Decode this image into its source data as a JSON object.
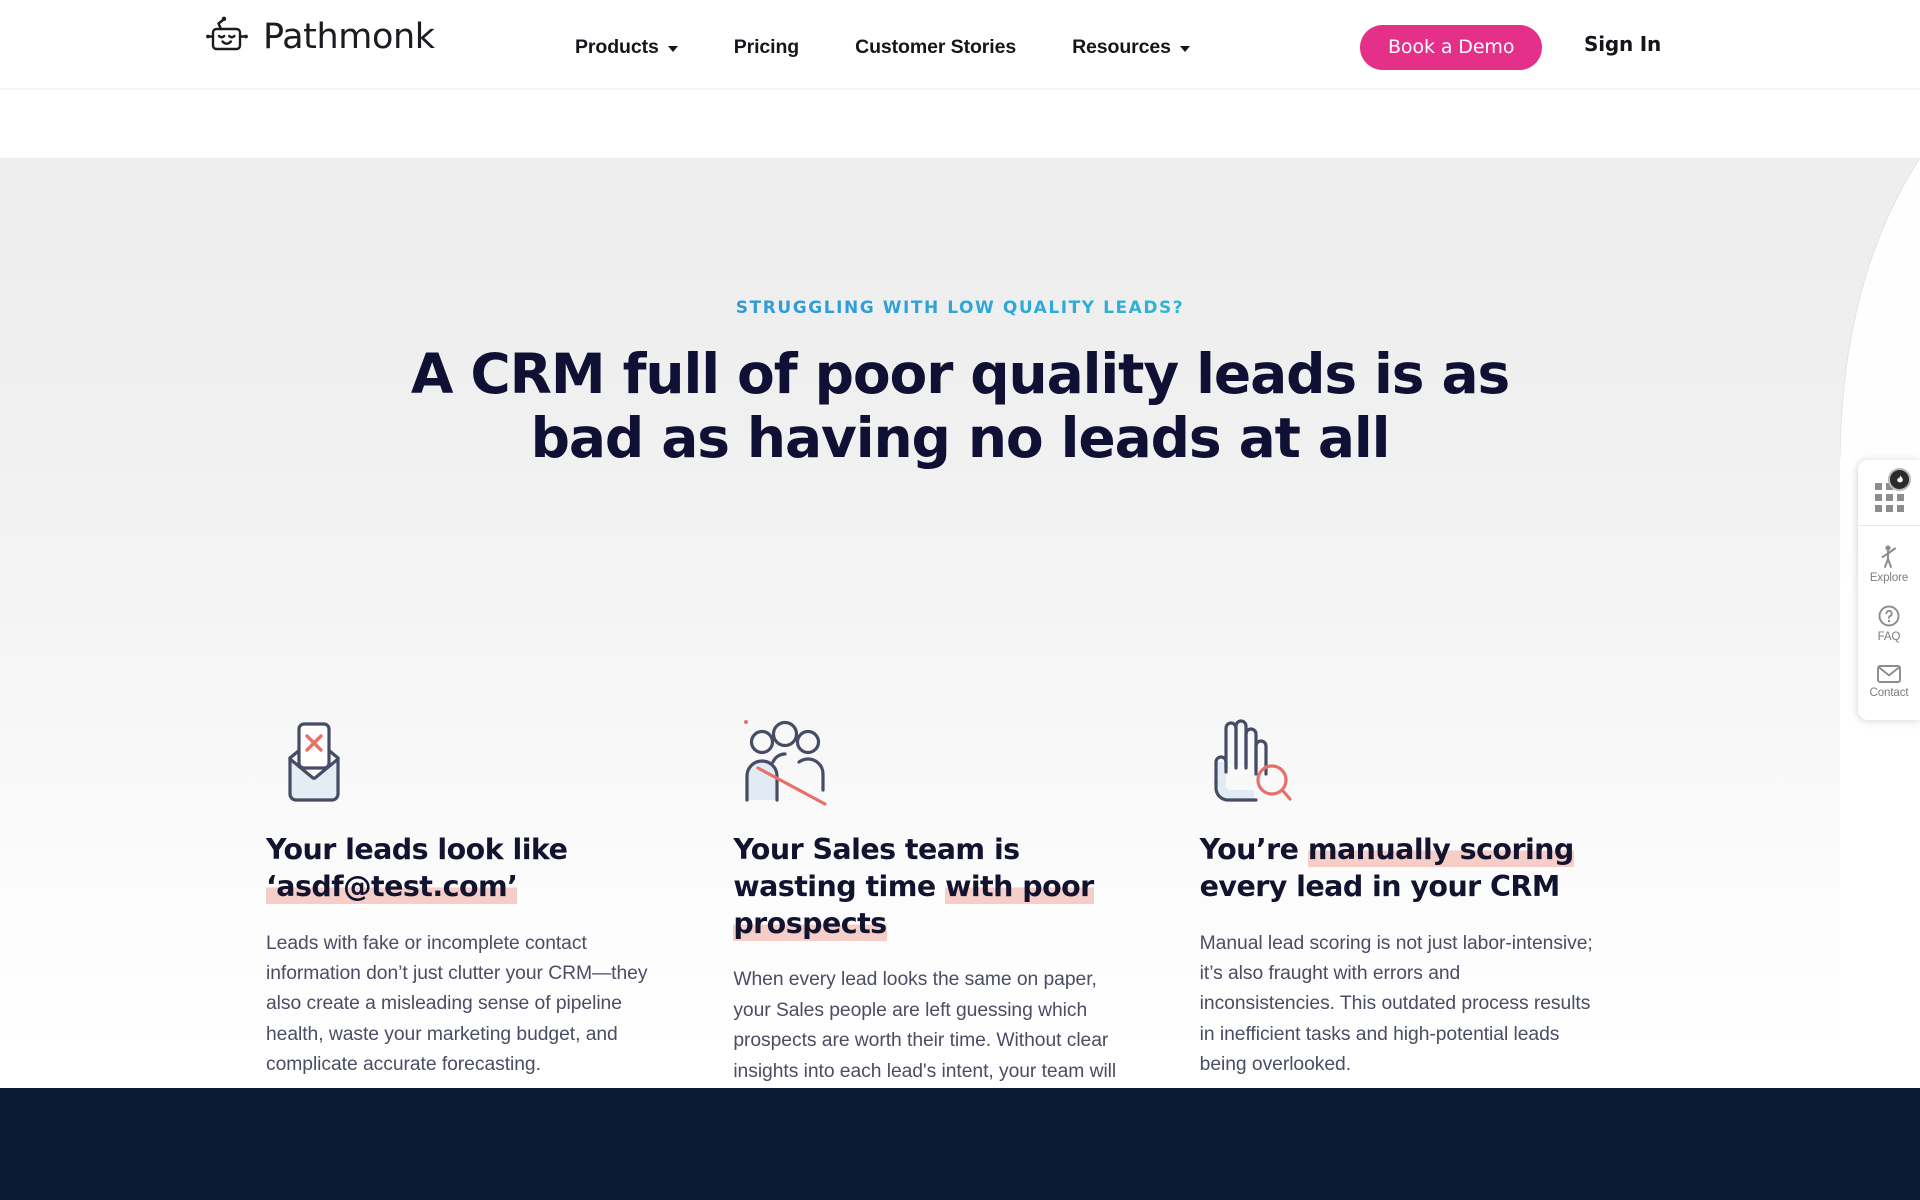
{
  "header": {
    "brand": "Pathmonk",
    "brand_icon": "robot-logo-icon",
    "nav": [
      {
        "label": "Products",
        "has_caret": true,
        "name": "nav-products"
      },
      {
        "label": "Pricing",
        "has_caret": false,
        "name": "nav-pricing"
      },
      {
        "label": "Customer Stories",
        "has_caret": false,
        "name": "nav-customer-stories"
      },
      {
        "label": "Resources",
        "has_caret": true,
        "name": "nav-resources"
      }
    ],
    "cta_label": "Book a Demo",
    "signin_label": "Sign In",
    "cta_color": "#e5308a"
  },
  "hero": {
    "eyebrow": "STRUGGLING WITH LOW QUALITY LEADS?",
    "eyebrow_gradient_from": "#3d7fd4",
    "eyebrow_gradient_to": "#36dbe0",
    "headline": "A CRM full of poor quality leads is as bad as having no leads at all",
    "headline_color": "#0f1033"
  },
  "cards": [
    {
      "icon": "envelope-x-icon",
      "title_plain": "Your leads look like ",
      "title_highlight": "‘asdf@test.com’",
      "body": "Leads with fake or incomplete contact information don’t just clutter your CRM—they also create a misleading sense of pipeline health, waste your marketing budget, and complicate accurate forecasting."
    },
    {
      "icon": "people-slash-icon",
      "title_plain": "Your Sales team is wasting time ",
      "title_highlight": "with poor prospects",
      "body": "When every lead looks the same on paper, your Sales people are left guessing which prospects are worth their time. Without clear insights into each lead's intent, your team will wast efforts and miss sales targets."
    },
    {
      "icon": "hand-magnifier-icon",
      "title_plain": "You’re ",
      "title_highlight": "manually scoring",
      "title_tail": " every lead in your CRM",
      "body": "Manual lead scoring is not just labor-intensive; it’s also fraught with errors and inconsistencies. This outdated process results in inefficient tasks and high-potential leads being overlooked."
    }
  ],
  "highlight_color": "#f6cdc7",
  "widget": {
    "toggle_icon": "apps-grid-icon",
    "badge_icon": "flame-badge-icon",
    "items": [
      {
        "icon": "explore-person-icon",
        "label": "Explore"
      },
      {
        "icon": "question-circle-icon",
        "label": "FAQ"
      },
      {
        "icon": "envelope-icon",
        "label": "Contact"
      }
    ]
  },
  "footer_band": {
    "color": "#0a1a33"
  }
}
